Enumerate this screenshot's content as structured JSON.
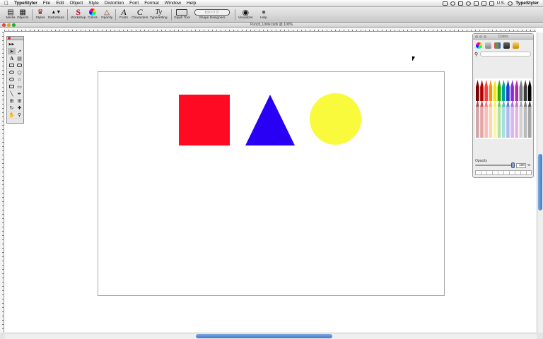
{
  "menubar": {
    "app_name": "TypeStyler",
    "items": [
      "File",
      "Edit",
      "Object",
      "Style",
      "Distortion",
      "Font",
      "Format",
      "Window",
      "Help"
    ],
    "locale": "U.S.",
    "right_app": "TypeStyler"
  },
  "toolbar": {
    "media": "Media",
    "objects": "Objects",
    "styles": "Styles",
    "distortions": "Distortions",
    "workshop": "Workshop",
    "colors": "Colors",
    "opacity": "Opacity",
    "fonts": "Fonts",
    "characters": "Characters",
    "typesetting": "Typesetting",
    "glyph_tool": "Glyph Tool",
    "shape_designers": "Shape Designers",
    "visualizer": "Visualizer",
    "help": "Help"
  },
  "document": {
    "title": "Punch_Unite.tsdx @ 100%"
  },
  "shapes": [
    {
      "name": "square",
      "color": "#ff0a22"
    },
    {
      "name": "triangle",
      "color": "#2a00f5"
    },
    {
      "name": "circle",
      "color": "#f9fa3c"
    }
  ],
  "colors_palette": {
    "title": "Colors",
    "opacity_label": "Opacity",
    "opacity_value": "100",
    "opacity_unit": "%",
    "opacity_level": 1.0
  },
  "crayon_colors": [
    "#7a0000",
    "#b00000",
    "#ff3b3b",
    "#ff8c1a",
    "#f2e900",
    "#26b000",
    "#00a0a0",
    "#1e3fd6",
    "#8a2ad6",
    "#b02ab0",
    "#7a7a7a",
    "#3a3a3a",
    "#000000"
  ]
}
